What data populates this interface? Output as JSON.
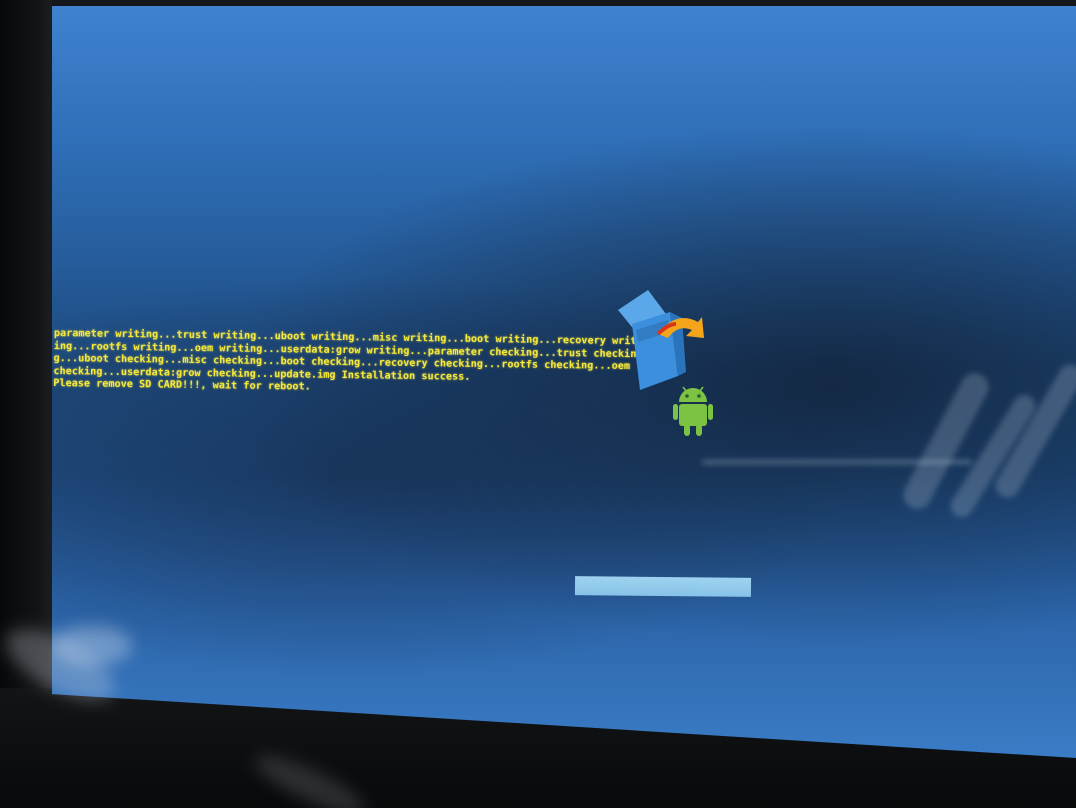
{
  "recovery": {
    "log_lines": [
      "parameter writing...trust writing...uboot writing...misc writing...boot writing...recovery writ",
      "ing...rootfs writing...oem writing...userdata:grow writing...parameter checking...trust checkin",
      "g...uboot checking...misc checking...boot checking...recovery checking...rootfs checking...oem",
      "checking...userdata:grow checking...update.img Installation success.",
      "Please remove SD CARD!!!, wait for reboot."
    ],
    "progress_fraction": 1.0,
    "icons": {
      "update": "system-update-box-icon",
      "robot": "android-robot-icon"
    },
    "colors": {
      "log_text": "#f5e83a",
      "screen_top": "#3f82cf",
      "screen_mid": "#1d4a7d",
      "progress": "#9fd2ef",
      "android_green": "#7cc243"
    }
  }
}
